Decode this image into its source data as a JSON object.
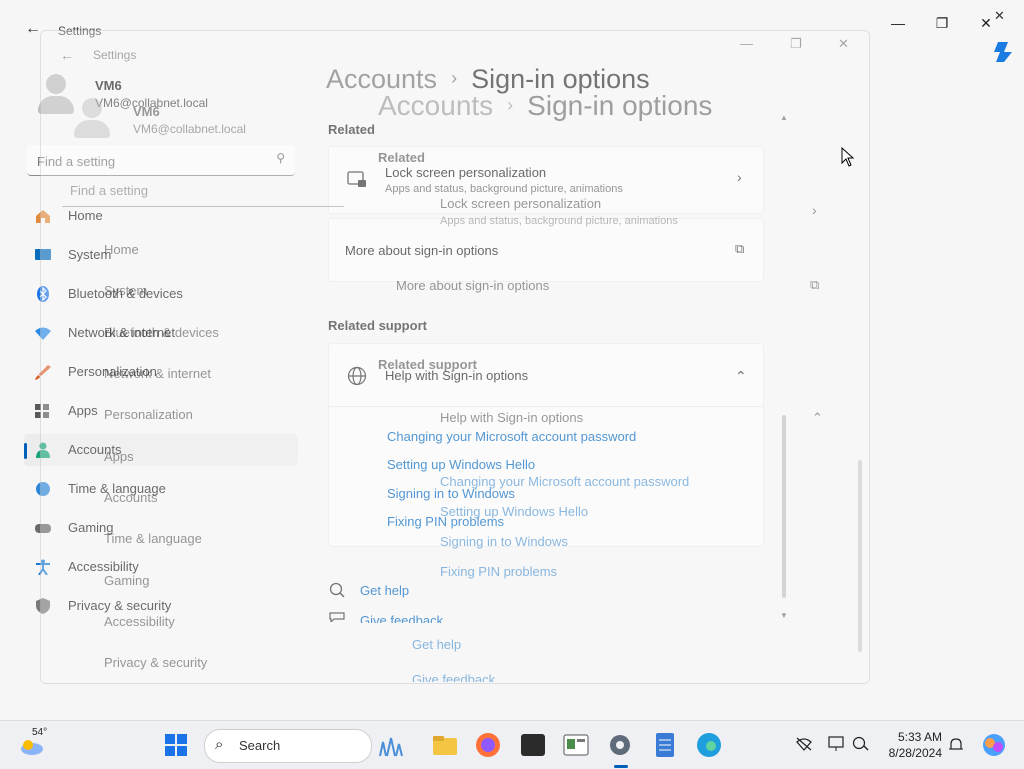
{
  "window": {
    "app_title": "Settings",
    "back": "←",
    "minimize": "—",
    "maximize": "❐",
    "close": "✕"
  },
  "account": {
    "name": "VM6",
    "email": "VM6@collabnet.local"
  },
  "search": {
    "placeholder": "Find a setting",
    "icon": "⚲"
  },
  "nav": {
    "items": [
      {
        "label": "Home",
        "color": "#e08a3c"
      },
      {
        "label": "System",
        "color": "#0a6ebd"
      },
      {
        "label": "Bluetooth & devices",
        "color": "#1a73e8"
      },
      {
        "label": "Network & internet",
        "color": "#2a8be6"
      },
      {
        "label": "Personalization",
        "color": "#d9622b"
      },
      {
        "label": "Apps",
        "color": "#5a5a5a"
      },
      {
        "label": "Accounts",
        "color": "#1aa37a"
      },
      {
        "label": "Time & language",
        "color": "#2f86d6"
      },
      {
        "label": "Gaming",
        "color": "#6a6a6a"
      },
      {
        "label": "Accessibility",
        "color": "#1a78d2"
      },
      {
        "label": "Privacy & security",
        "color": "#7a7a7a"
      }
    ],
    "active_index": 6
  },
  "breadcrumb": {
    "parent": "Accounts",
    "separator": "›",
    "current": "Sign-in options"
  },
  "related": {
    "heading": "Related",
    "lock_screen": {
      "title": "Lock screen personalization",
      "subtitle": "Apps and status, background picture, animations",
      "chevron": "›"
    },
    "more_about": {
      "title": "More about sign-in options",
      "icon": "⧉"
    }
  },
  "related_support": {
    "heading": "Related support",
    "help_title": "Help with Sign-in options",
    "chevron": "⌃",
    "links": [
      "Changing your Microsoft account password",
      "Setting up Windows Hello",
      "Signing in to Windows",
      "Fixing PIN problems"
    ]
  },
  "footer": {
    "get_help": "Get help",
    "give_feedback": "Give feedback"
  },
  "taskbar": {
    "weather_temp": "54°",
    "search_label": "Search",
    "time": "5:33 AM",
    "date": "8/28/2024"
  },
  "colors": {
    "accent": "#005fb8",
    "link": "#0067c0"
  }
}
